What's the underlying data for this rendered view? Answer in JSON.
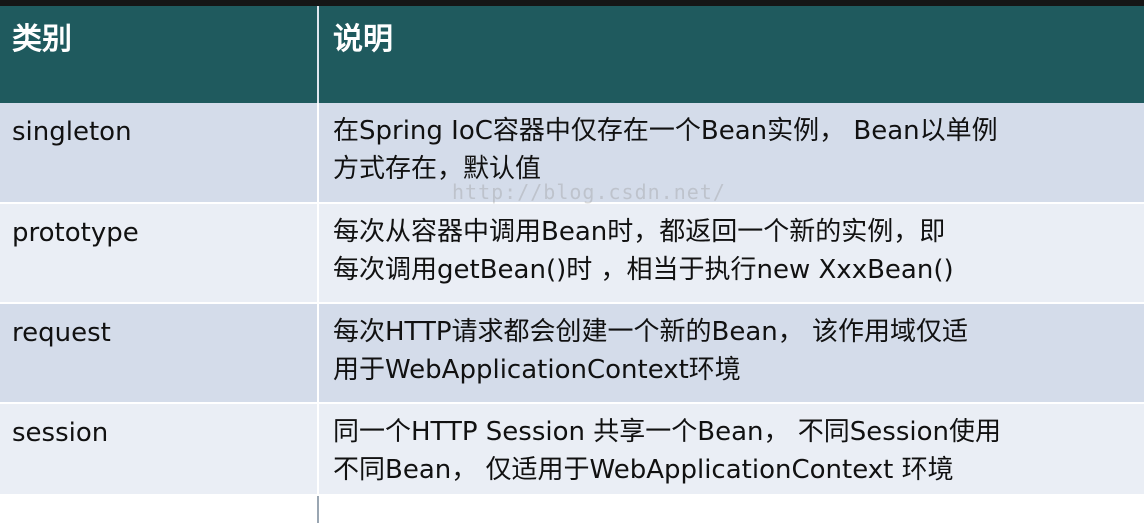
{
  "table": {
    "headers": {
      "category": "类别",
      "description": "说明"
    },
    "rows": [
      {
        "category": "singleton",
        "description_lines": [
          "在Spring IoC容器中仅存在一个Bean实例， Bean以单例",
          "方式存在，默认值"
        ]
      },
      {
        "category": "prototype",
        "description_lines": [
          "每次从容器中调用Bean时，都返回一个新的实例，即",
          "每次调用getBean()时 ，相当于执行new XxxBean()"
        ]
      },
      {
        "category": "request",
        "description_lines": [
          "每次HTTP请求都会创建一个新的Bean， 该作用域仅适",
          "用于WebApplicationContext环境"
        ]
      },
      {
        "category": "session",
        "description_lines": [
          "同一个HTTP Session 共享一个Bean， 不同Session使用",
          "不同Bean， 仅适用于WebApplicationContext 环境"
        ]
      }
    ]
  },
  "watermark": "http://blog.csdn.net/",
  "colors": {
    "header_bg": "#1f5a5e",
    "row_dark": "#d4dcea",
    "row_light": "#eaeef5"
  }
}
